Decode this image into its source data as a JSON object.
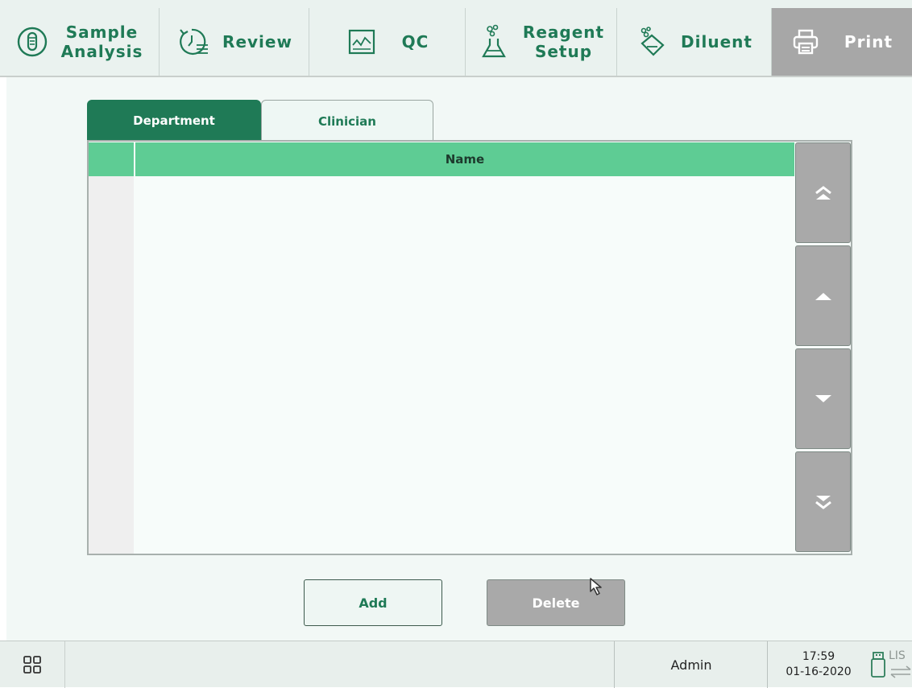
{
  "nav": {
    "sample_analysis": {
      "line1": "Sample",
      "line2": "Analysis"
    },
    "review": "Review",
    "qc": "QC",
    "reagent_setup": {
      "line1": "Reagent",
      "line2": "Setup"
    },
    "diluent": "Diluent",
    "print": "Print",
    "active": "Print"
  },
  "tabs": {
    "department": "Department",
    "clinician": "Clinician",
    "selected": "Department"
  },
  "table": {
    "column_name": "Name",
    "rows": []
  },
  "buttons": {
    "add": "Add",
    "delete": "Delete"
  },
  "status": {
    "user": "Admin",
    "time": "17:59",
    "date": "01-16-2020",
    "lis": "LIS"
  },
  "icons": {
    "nav": [
      "test-tube-icon",
      "review-history-icon",
      "qc-chart-icon",
      "flask-icon",
      "diluent-bottle-icon",
      "printer-icon"
    ],
    "scroll": [
      "double-chevron-up-icon",
      "chevron-up-icon",
      "chevron-down-icon",
      "double-chevron-down-icon"
    ],
    "status": [
      "grid-menu-icon",
      "usb-icon",
      "transfer-arrows-icon"
    ]
  },
  "colors": {
    "brand_green": "#1f7a56",
    "header_green": "#5ecc94",
    "disabled_gray": "#a9a9a9"
  }
}
